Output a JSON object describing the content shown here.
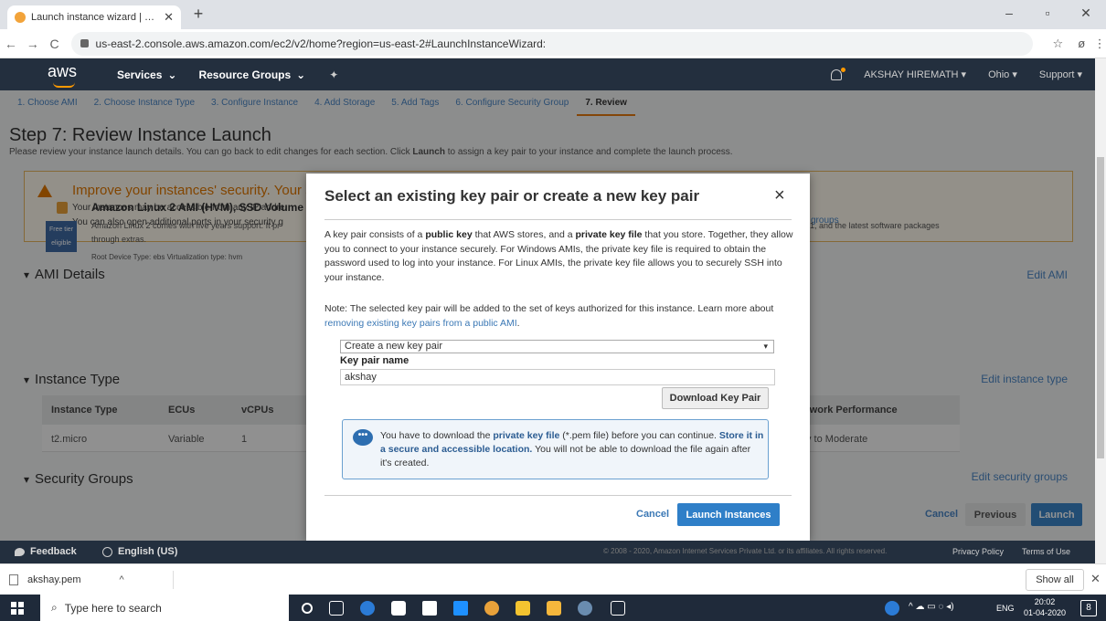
{
  "browser": {
    "tab_title": "Launch instance wizard | EC2 Ma",
    "url": "us-east-2.console.aws.amazon.com/ec2/v2/home?region=us-east-2#LaunchInstanceWizard:",
    "new_tab": "+",
    "close": "✕",
    "back": "←",
    "forward": "→",
    "reload": "C",
    "star": "☆"
  },
  "aws_nav": {
    "logo": "aws",
    "services": "Services",
    "resource_groups": "Resource Groups",
    "user": "AKSHAY HIREMATH",
    "region": "Ohio",
    "support": "Support"
  },
  "wizard": {
    "steps": [
      "1. Choose AMI",
      "2. Choose Instance Type",
      "3. Configure Instance",
      "4. Add Storage",
      "5. Add Tags",
      "6. Configure Security Group",
      "7. Review"
    ],
    "active_step": 6,
    "title": "Step 7: Review Instance Launch",
    "subtitle_pre": "Please review your instance launch details. You can go back to edit changes for each section. Click ",
    "subtitle_bold": "Launch",
    "subtitle_post": " to assign a key pair to your instance and complete the launch process.",
    "warning": {
      "title": "Improve your instances' security. Your se",
      "line1": "Your instances may be accessible from any IP addre",
      "line2": "You can also open additional ports in your security g",
      "groups": "groups"
    },
    "ami_section": "AMI Details",
    "edit_ami": "Edit AMI",
    "ami_name": "Amazon Linux 2 AMI (HVM), SSD Volume T",
    "free_tier": "Free tier eligible",
    "ami_desc1": "Amazon Linux 2 comes with five years support. It pr",
    "ami_desc2": "through extras.",
    "ami_desc3": "Root Device Type: ebs    Virtualization type: hvm",
    "ami_desc_right": "1, and the latest software packages",
    "instance_section": "Instance Type",
    "edit_instance": "Edit instance type",
    "table_headers": [
      "Instance Type",
      "ECUs",
      "vCPUs",
      "twork Performance"
    ],
    "table_row": [
      "t2.micro",
      "Variable",
      "1",
      "v to Moderate"
    ],
    "security_section": "Security Groups",
    "edit_security": "Edit security groups",
    "cancel": "Cancel",
    "previous": "Previous",
    "launch": "Launch"
  },
  "modal": {
    "title": "Select an existing key pair or create a new key pair",
    "close": "×",
    "p1_a": "A key pair consists of a ",
    "p1_b": "public key",
    "p1_c": " that AWS stores, and a ",
    "p1_d": "private key file",
    "p1_e": " that you store. Together, they allow you to connect to your instance securely. For Windows AMIs, the private key file is required to obtain the password used to log into your instance. For Linux AMIs, the private key file allows you to securely SSH into your instance.",
    "p2_a": "Note: The selected key pair will be added to the set of keys authorized for this instance. Learn more about ",
    "p2_link": "removing existing key pairs from a public AMI",
    "p2_b": ".",
    "select_value": "Create a new key pair",
    "key_pair_label": "Key pair name",
    "key_pair_value": "akshay",
    "download": "Download Key Pair",
    "info_a": "You have to download the ",
    "info_b": "private key file",
    "info_c": " (*.pem file) before you can continue. ",
    "info_d": "Store it in a secure and accessible location.",
    "info_e": " You will not be able to download the file again after it's created.",
    "cancel": "Cancel",
    "launch_instances": "Launch Instances"
  },
  "footer": {
    "feedback": "Feedback",
    "language": "English (US)",
    "copyright": "© 2008 - 2020, Amazon Internet Services Private Ltd. or its affiliates. All rights reserved.",
    "privacy": "Privacy Policy",
    "terms": "Terms of Use"
  },
  "downloads": {
    "file": "akshay.pem",
    "show_all": "Show all"
  },
  "taskbar": {
    "search_placeholder": "Type here to search",
    "lang": "ENG",
    "time": "20:02",
    "date": "01-04-2020",
    "notif": "8"
  }
}
